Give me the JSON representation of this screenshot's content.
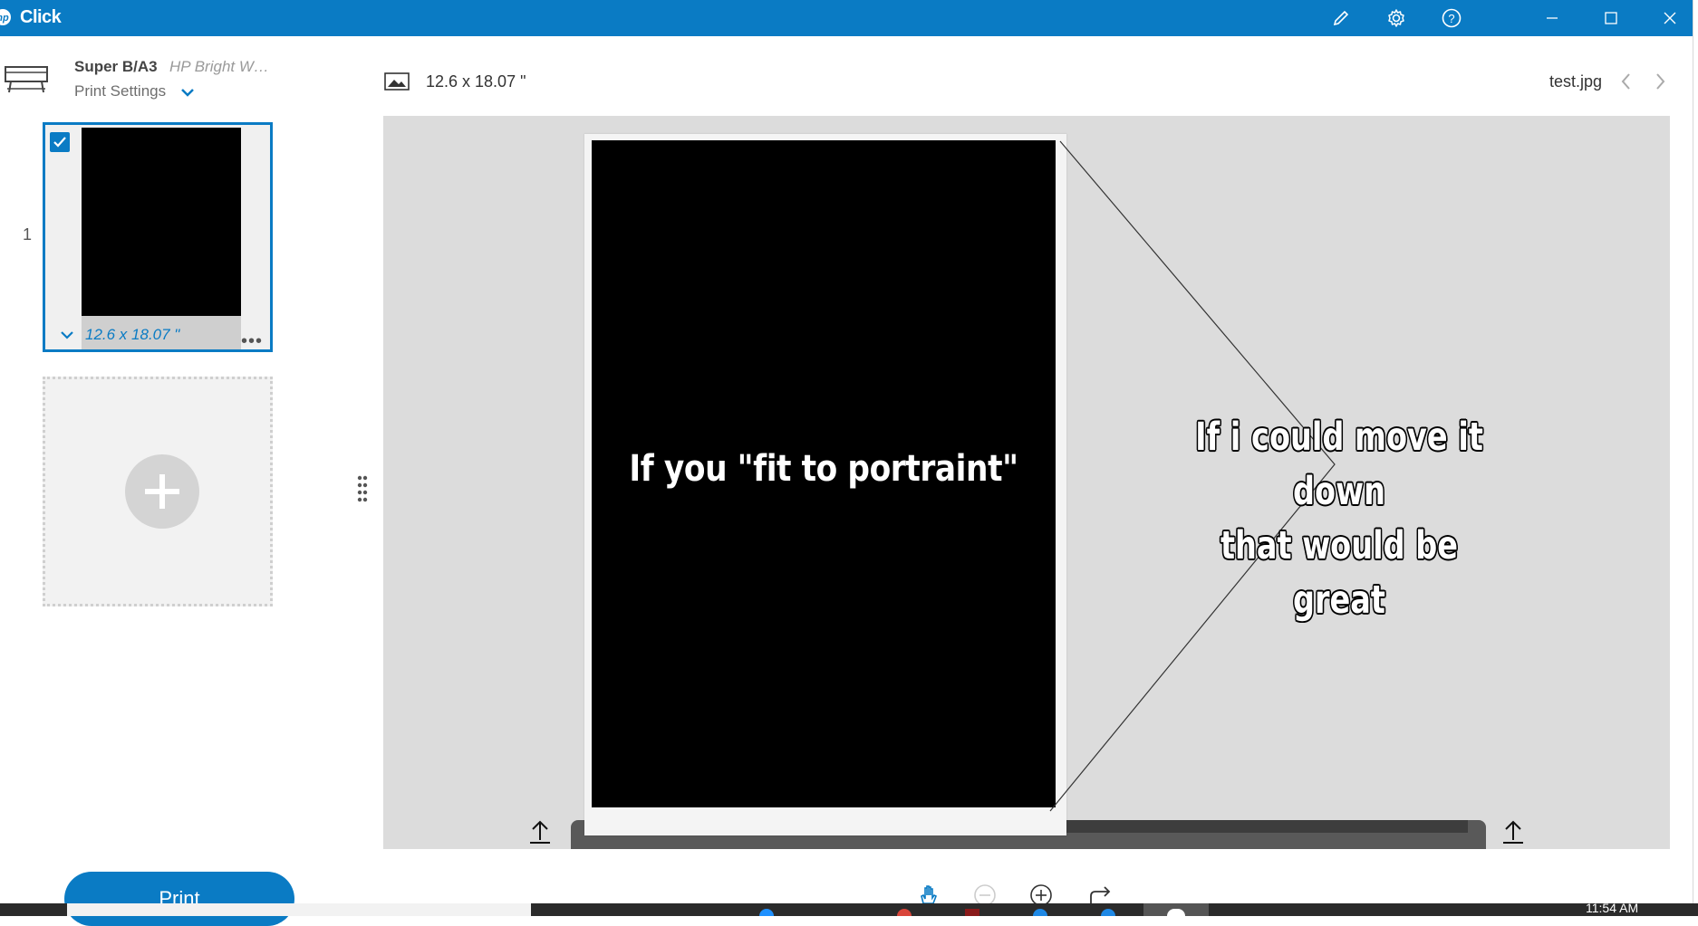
{
  "window": {
    "app_title": "Click",
    "icons": {
      "logo": "hp-logo-icon",
      "edit": "pencil-icon",
      "settings": "gear-icon",
      "help": "help-icon",
      "minimize": "minimize-icon",
      "maximize": "maximize-icon",
      "close": "close-icon"
    },
    "accent_color": "#0a7bc4"
  },
  "sidebar": {
    "printer_name": "Super B/A3",
    "paper_name": "HP Bright W…",
    "print_settings_label": "Print Settings",
    "pages": [
      {
        "number": "1",
        "size_label": "12.6 x 18.07 \"",
        "checked": true
      }
    ],
    "more_label": "•••"
  },
  "preview": {
    "size_label": "12.6 x 18.07 \"",
    "file_name": "test.jpg",
    "image_text": "If you \"fit to portraint\"",
    "annotation_line1": "If i could move it down",
    "annotation_line2": "that would be great"
  },
  "actions": {
    "print_label": "Print"
  },
  "taskbar": {
    "clock": "11:54 AM"
  }
}
